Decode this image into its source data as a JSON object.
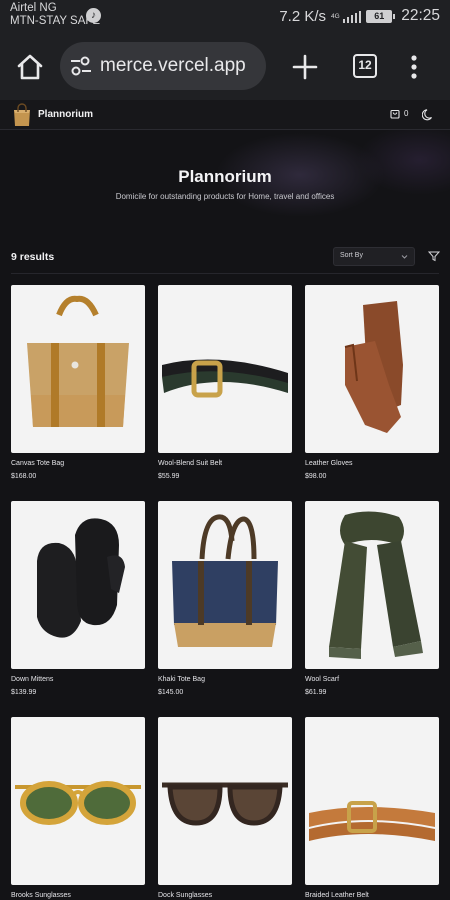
{
  "status_bar": {
    "carrier_line1": "Airtel NG",
    "carrier_line2": "MTN-STAY SAFE",
    "net_speed": "7.2 K/s",
    "net_type": "4G",
    "battery": "61",
    "time": "22:25"
  },
  "browser": {
    "url": "merce.vercel.app",
    "tab_count": "12"
  },
  "site": {
    "brand": "Plannorium",
    "cart_count": "0"
  },
  "hero": {
    "title": "Plannorium",
    "subtitle": "Domicile for outstanding products for Home, travel and offices"
  },
  "results": {
    "count_label": "9 results",
    "sort_label": "Sort By"
  },
  "products": [
    {
      "name": "Canvas Tote Bag",
      "price": "$168.00",
      "icon": "tote-bag-tan"
    },
    {
      "name": "Wool-Blend Suit Belt",
      "price": "$55.99",
      "icon": "belt-black"
    },
    {
      "name": "Leather Gloves",
      "price": "$98.00",
      "icon": "gloves-brown"
    },
    {
      "name": "Down Mittens",
      "price": "$139.99",
      "icon": "mittens-black"
    },
    {
      "name": "Khaki Tote Bag",
      "price": "$145.00",
      "icon": "tote-bag-navy"
    },
    {
      "name": "Wool Scarf",
      "price": "$61.99",
      "icon": "scarf-olive"
    },
    {
      "name": "Brooks Sunglasses",
      "price": "",
      "icon": "sunglasses-amber"
    },
    {
      "name": "Dock Sunglasses",
      "price": "",
      "icon": "sunglasses-dark"
    },
    {
      "name": "Braided Leather Belt",
      "price": "",
      "icon": "belt-braided"
    }
  ],
  "colors": {
    "page_bg": "#131316",
    "browser_bg": "#1f2023",
    "url_pill": "#35363a",
    "card_bg": "#f3f3f3"
  }
}
